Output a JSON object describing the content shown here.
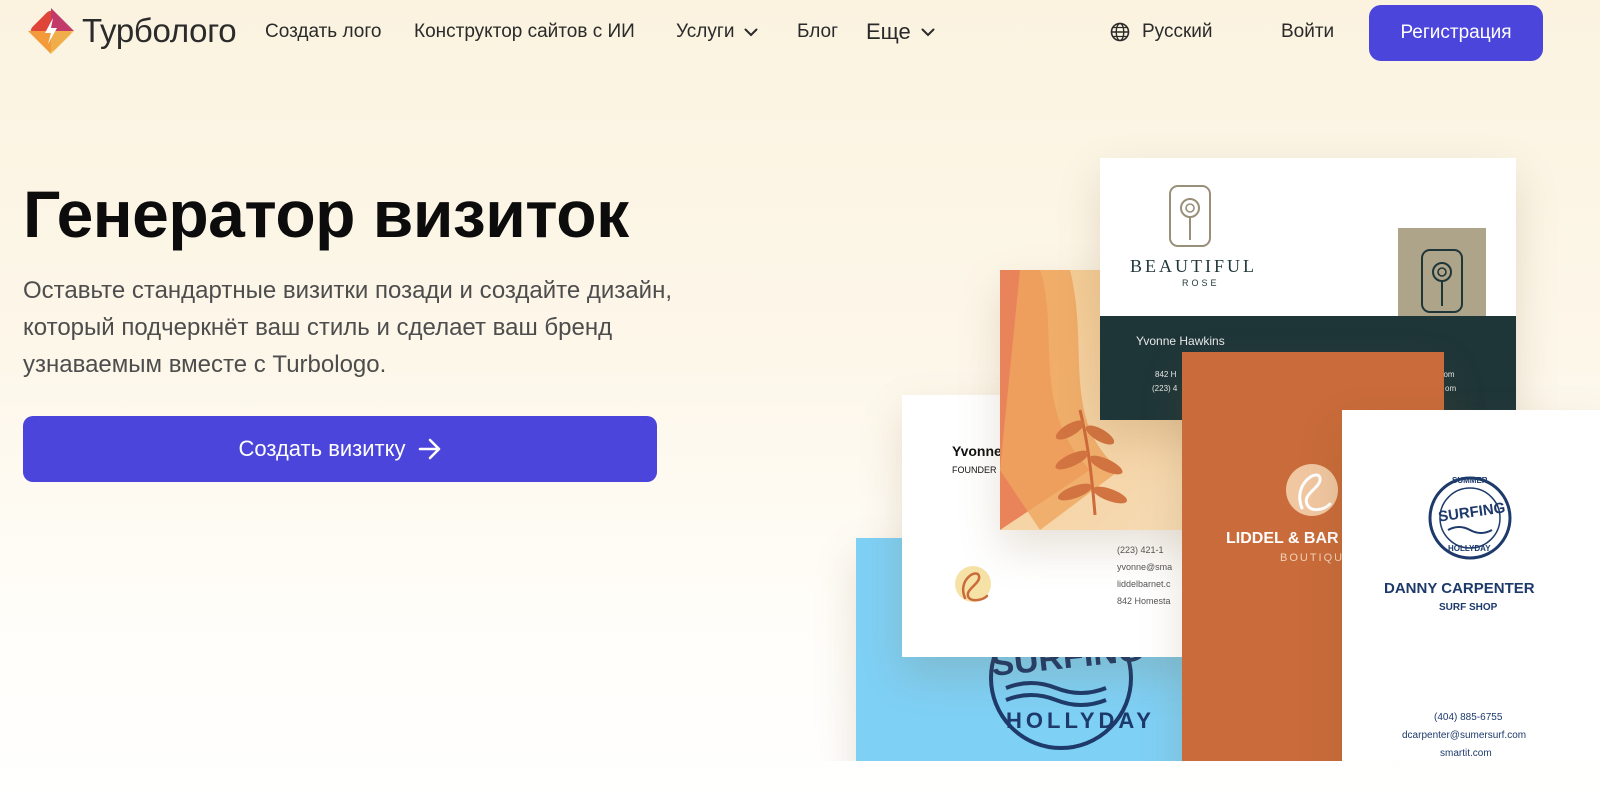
{
  "nav": {
    "brand": "Турболого",
    "links": [
      {
        "label": "Создать лого"
      },
      {
        "label": "Конструктор сайтов с ИИ"
      },
      {
        "label": "Услуги"
      },
      {
        "label": "Блог"
      },
      {
        "label": "Еще"
      }
    ],
    "language": "Русский",
    "login": "Войти",
    "signup": "Регистрация"
  },
  "hero": {
    "title": "Генератор визиток",
    "description": "Оставьте стандартные визитки позади и создайте дизайн, который подчеркнёт ваш стиль и сделает ваш бренд узнаваемым вместе с Turbologo.",
    "cta": "Создать визитку"
  },
  "cards": {
    "rose": {
      "brand": "BEAUTIFUL",
      "brand_sub": "ROSE",
      "name": "Yvonne Hawkins",
      "line1": "842 H",
      "line1_end": "t.com",
      "line2": "(223) 4",
      "line2_end": "om"
    },
    "white_left": {
      "name": "Yvonne",
      "role": "FOUNDER",
      "phone": "(223) 421-1",
      "email": "yvonne@sma",
      "site": "liddelbarnet.c",
      "address": "842 Homesta"
    },
    "orange": {
      "brand": "LIDDEL & BAR",
      "sub": "BOUTIQU"
    },
    "blue": {
      "text": "SURFING",
      "text2": "HOLLYDAY"
    },
    "surf": {
      "badge_top": "SUMMER",
      "badge_mid": "SURFING",
      "badge_bottom": "HOLLYDAY",
      "name": "DANNY CARPENTER",
      "shop": "SURF SHOP",
      "phone": "(404) 885-6755",
      "email": "dcarpenter@sumersurf.com",
      "site": "smartit.com"
    }
  },
  "colors": {
    "accent": "#4b45dc",
    "background": "#fbf3e0"
  }
}
